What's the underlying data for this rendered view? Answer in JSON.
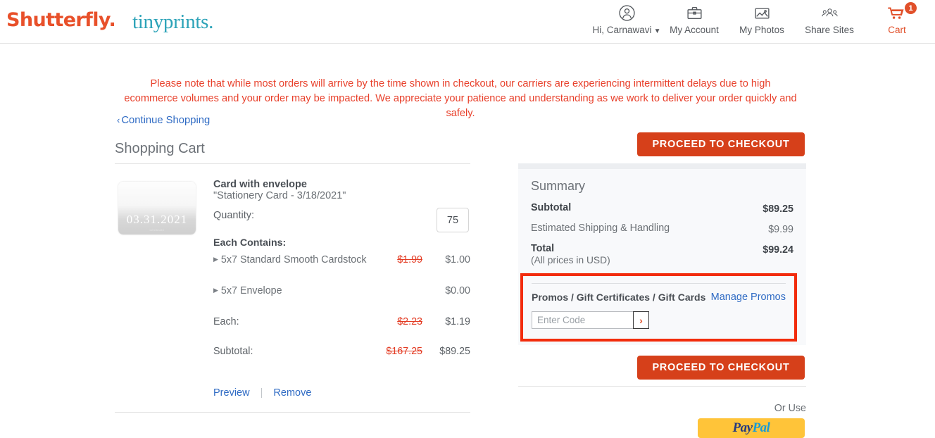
{
  "header": {
    "logo_shutterfly": "Shutterfly",
    "logo_tinyprints": "tinyprints",
    "nav": [
      {
        "label": "Hi, Carnawavi",
        "icon": "user-circle-icon",
        "has_caret": true
      },
      {
        "label": "My Account",
        "icon": "briefcase-icon",
        "has_caret": false
      },
      {
        "label": "My Photos",
        "icon": "photo-icon",
        "has_caret": false
      },
      {
        "label": "Share Sites",
        "icon": "people-icon",
        "has_caret": false
      },
      {
        "label": "Cart",
        "icon": "cart-icon",
        "badge": "1",
        "has_caret": false
      }
    ]
  },
  "notice": {
    "text": "Please note that while most orders will arrive by the time shown in checkout, our carriers are experiencing intermittent delays due to high ecommerce volumes and your order may be impacted. We appreciate your patience and understanding as we work to deliver your order quickly and safely.",
    "color": "#e8402b"
  },
  "continue_shopping": {
    "label": "Continue Shopping",
    "chevron": "‹"
  },
  "page_title": "Shopping Cart",
  "checkout_button_label": "PROCEED TO CHECKOUT",
  "product": {
    "thumbnail_date": "03.31.2021",
    "thumbnail_caption": "celebrate",
    "title": "Card with envelope",
    "subtitle": "\"Stationery Card - 3/18/2021\"",
    "quantity_label": "Quantity:",
    "quantity_value": "75",
    "each_contains_label": "Each Contains:",
    "lines": [
      {
        "label": "5x7 Standard Smooth Cardstock",
        "old_price": "$1.99",
        "new_price": "$1.00",
        "bulleted": true,
        "bold": false
      },
      {
        "label": "5x7 Envelope",
        "old_price": "",
        "new_price": "$0.00",
        "bulleted": true,
        "bold": false
      },
      {
        "label": "Each:",
        "old_price": "$2.23",
        "new_price": "$1.19",
        "bulleted": false,
        "bold": true
      },
      {
        "label": "Subtotal:",
        "old_price": "$167.25",
        "new_price": "$89.25",
        "bulleted": false,
        "bold": true
      }
    ],
    "preview_label": "Preview",
    "remove_label": "Remove",
    "link_separator": "|"
  },
  "summary": {
    "title": "Summary",
    "rows": [
      {
        "key": "Subtotal",
        "value": "$89.25",
        "bold": true
      },
      {
        "key": "Estimated Shipping & Handling",
        "value": "$9.99",
        "bold": false
      },
      {
        "key": "Total",
        "value": "$99.24",
        "bold": true
      }
    ],
    "currency_note": "(All prices in USD)"
  },
  "promos": {
    "label": "Promos / Gift Certificates / Gift Cards",
    "manage_label": "Manage Promos",
    "input_placeholder": "Enter Code",
    "input_value": "",
    "submit_glyph": "›",
    "highlight_color": "#f22c0c"
  },
  "footer": {
    "or_use_label": "Or Use",
    "paypal_pay": "Pay",
    "paypal_pal": "Pal"
  },
  "colors": {
    "brand_orange": "#e8502a",
    "button_red": "#d6401a",
    "link_blue": "#2f6bc4",
    "tinyprints_teal": "#2ca3b8",
    "strike_red": "#e33b23"
  }
}
